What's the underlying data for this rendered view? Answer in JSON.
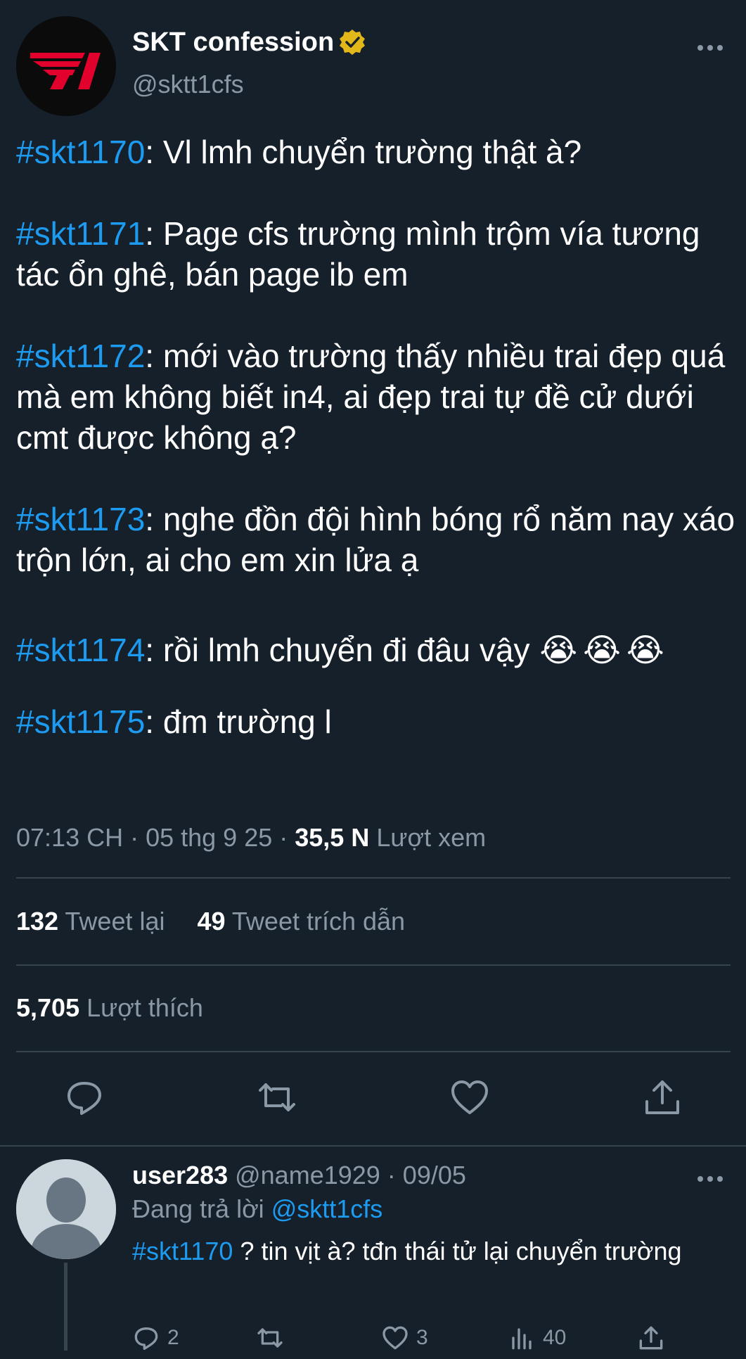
{
  "author": {
    "display_name": "SKT confession",
    "handle": "@sktt1cfs",
    "verified": true,
    "avatar_icon": "t1-logo-icon"
  },
  "tweet": {
    "confessions": [
      {
        "tag": "#skt1170",
        "text": ": Vl lmh chuyển trường thật à?"
      },
      {
        "tag": "#skt1171",
        "text": ": Page cfs trường mình trộm vía tương tác ổn ghê, bán page ib em"
      },
      {
        "tag": "#skt1172",
        "text": ": mới vào trường thấy nhiều trai đẹp quá mà em không biết in4, ai đẹp trai tự đề cử dưới cmt được không ạ?"
      },
      {
        "tag": "#skt1173",
        "text": ": nghe đồn đội hình bóng rổ năm nay xáo trộn lớn, ai cho em xin lửa ạ"
      },
      {
        "tag": "#skt1174",
        "text": ": rồi lmh chuyển đi đâu vậy",
        "emojis": [
          "😭",
          "😭",
          "😭"
        ]
      },
      {
        "tag": "#skt1175",
        "text": ": đm trường l"
      }
    ]
  },
  "meta": {
    "time": "07:13 CH",
    "sep1": " · ",
    "date": "05 thg 9 25",
    "sep2": " · ",
    "views": "35,5 N",
    "views_label": " Lượt xem"
  },
  "stats": {
    "retweets": "132",
    "retweets_label": " Tweet lại",
    "quotes": "49",
    "quotes_label": " Tweet trích dẫn",
    "likes": "5,705",
    "likes_label": " Lượt thích"
  },
  "actions": [
    "reply-icon",
    "retweet-icon",
    "like-icon",
    "share-icon"
  ],
  "reply": {
    "name": "user283",
    "handle": " @name1929",
    "sep": " · ",
    "date": "09/05",
    "replying_label": "Đang trả lời ",
    "replying_to": "@sktt1cfs",
    "tag": "#skt1170",
    "text": " ? tin vịt à? tđn thái tử lại chuyển trường",
    "counts": {
      "replies": "2",
      "likes": "3",
      "views": "40"
    }
  },
  "colors": {
    "background": "#15202b",
    "accent": "#1d9bf0",
    "muted": "#8b98a5",
    "divider": "#38444d",
    "verified": "#e2b719"
  }
}
